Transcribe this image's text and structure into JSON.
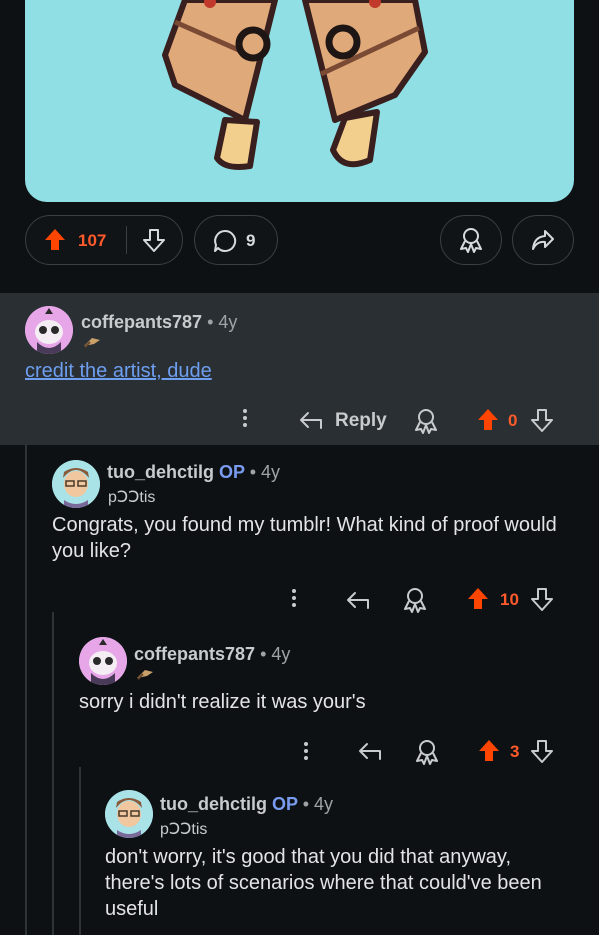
{
  "post": {
    "upvotes": "107",
    "comment_count": "9",
    "colors": {
      "upvote": "#ff4500",
      "link": "#6d9ef0",
      "op_tag": "#7a9cf0"
    }
  },
  "comments": [
    {
      "username": "coffepants787",
      "age": "• 4y",
      "text": "credit the artist, dude",
      "reply_label": "Reply",
      "score": "0"
    },
    {
      "username": "tuo_dehctilg",
      "op_label": "OP",
      "age": "• 4y",
      "flair": "pↃↃtis",
      "text": "Congrats, you found my tumblr! What kind of proof would you like?",
      "score": "10"
    },
    {
      "username": "coffepants787",
      "age": "• 4y",
      "text": "sorry i didn't realize it was your's",
      "score": "3"
    },
    {
      "username": "tuo_dehctilg",
      "op_label": "OP",
      "age": "• 4y",
      "flair": "pↃↃtis",
      "text": "don't worry, it's good that you did that anyway, there's lots of scenarios where that could've been useful"
    }
  ]
}
